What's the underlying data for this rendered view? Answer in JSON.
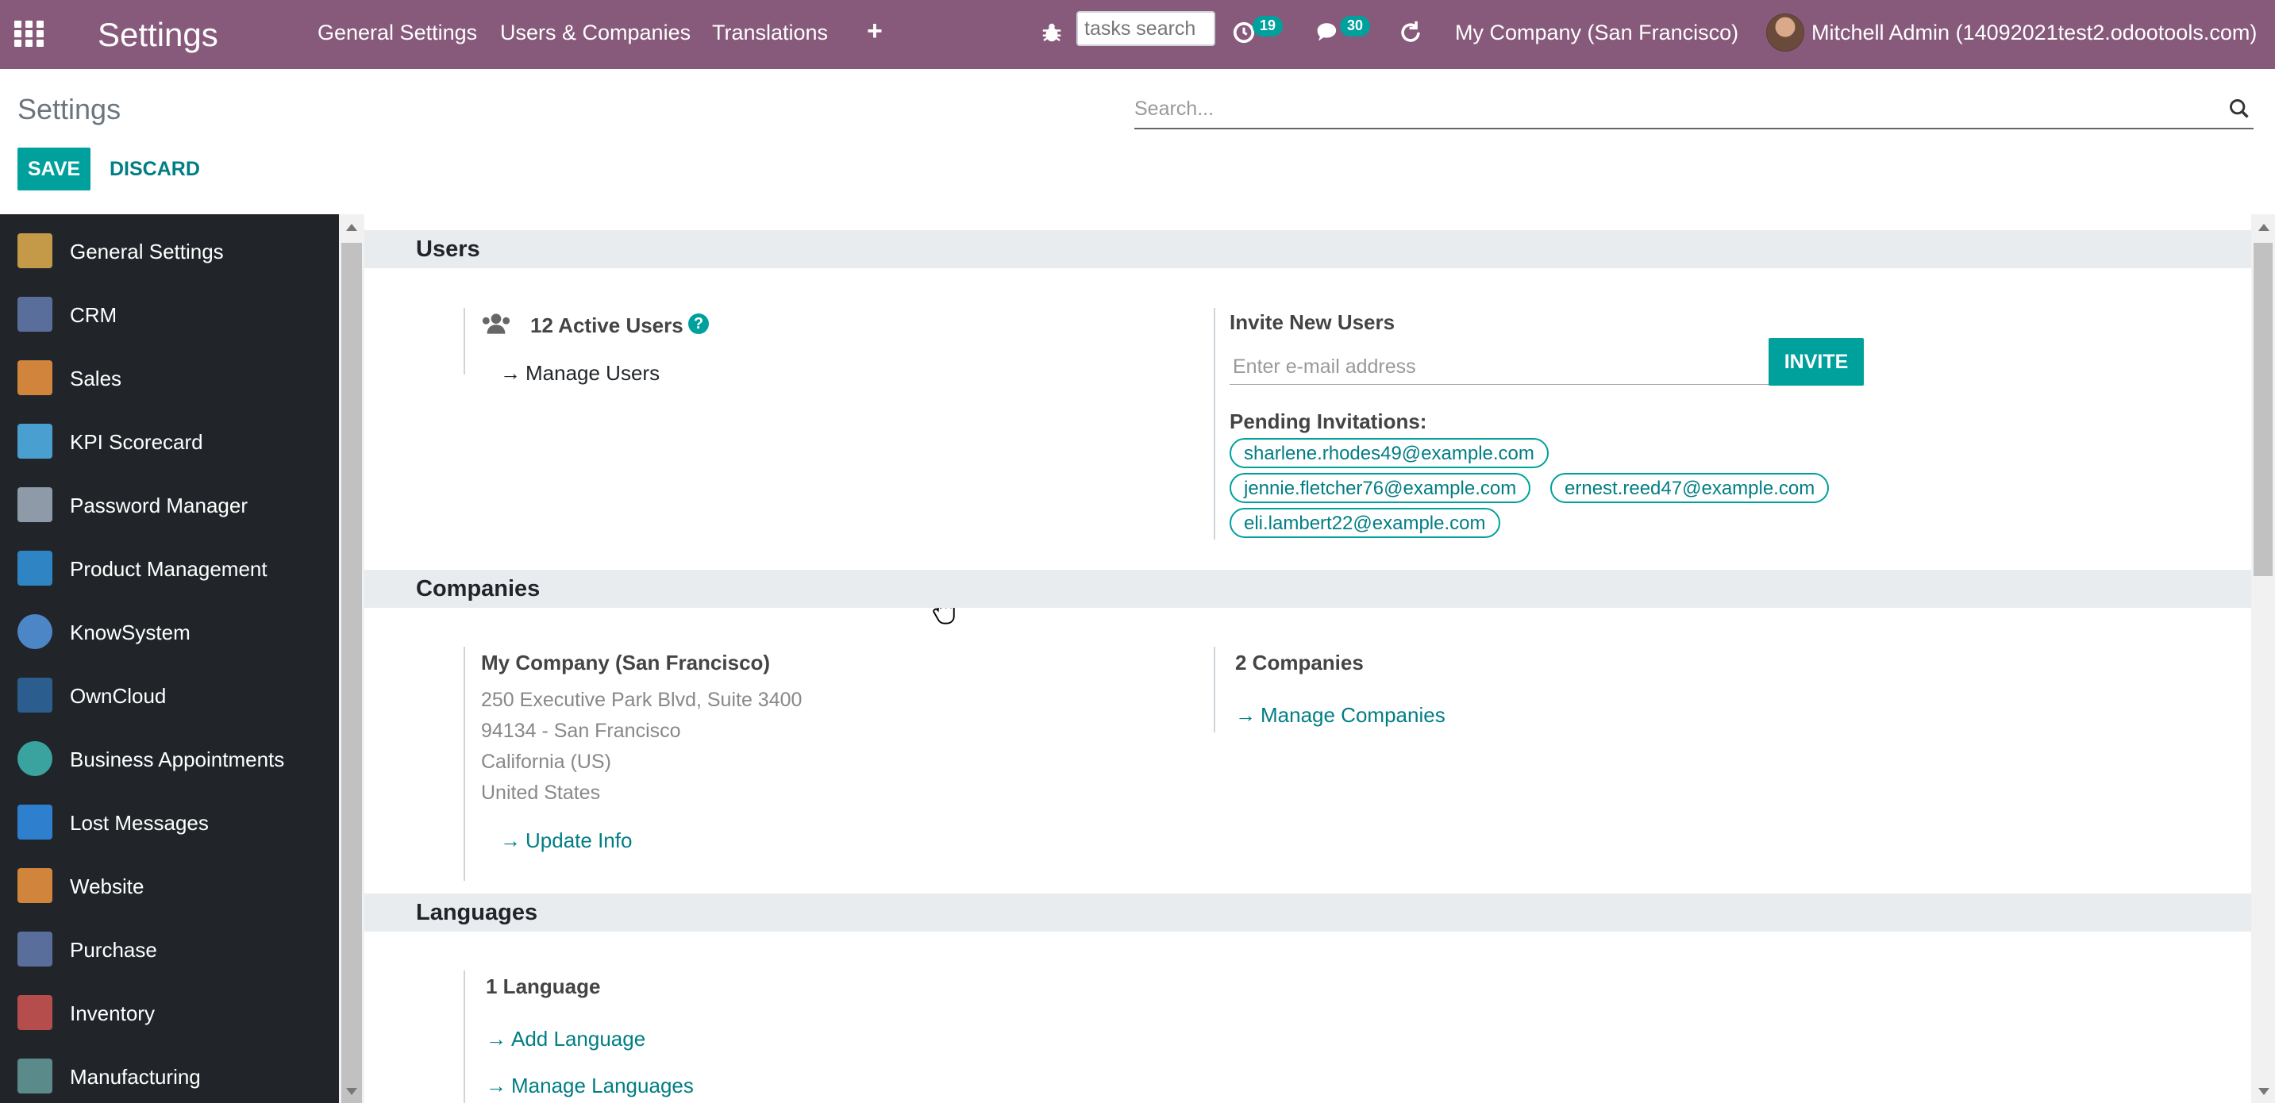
{
  "topbar": {
    "app_title": "Settings",
    "menu": [
      "General Settings",
      "Users & Companies",
      "Translations"
    ],
    "tasks_search_placeholder": "tasks search",
    "activity_count": "19",
    "messages_count": "30",
    "company": "My Company (San Francisco)",
    "user": "Mitchell Admin (14092021test2.odootools.com)"
  },
  "control_panel": {
    "title": "Settings",
    "save_label": "SAVE",
    "discard_label": "DISCARD",
    "search_placeholder": "Search..."
  },
  "sidebar": {
    "items": [
      {
        "label": "General Settings",
        "icon": "gear-icon",
        "color": "#c49a49"
      },
      {
        "label": "CRM",
        "icon": "handshake-icon",
        "color": "#5a6e9c"
      },
      {
        "label": "Sales",
        "icon": "chart-line-icon",
        "color": "#d0843c"
      },
      {
        "label": "KPI Scorecard",
        "icon": "scorecard-icon",
        "color": "#4a9fd1"
      },
      {
        "label": "Password Manager",
        "icon": "key-icon",
        "color": "#8e9aa8"
      },
      {
        "label": "Product Management",
        "icon": "sliders-icon",
        "color": "#2f84c4"
      },
      {
        "label": "KnowSystem",
        "icon": "brain-icon",
        "color": "#4c86c7"
      },
      {
        "label": "OwnCloud",
        "icon": "cloud-icon",
        "color": "#2c5d8f"
      },
      {
        "label": "Business Appointments",
        "icon": "clock-icon",
        "color": "#3aa3a0"
      },
      {
        "label": "Lost Messages",
        "icon": "user-question-icon",
        "color": "#2f7fcf"
      },
      {
        "label": "Website",
        "icon": "globe-icon",
        "color": "#d0843c"
      },
      {
        "label": "Purchase",
        "icon": "credit-card-icon",
        "color": "#5a6e9c"
      },
      {
        "label": "Inventory",
        "icon": "box-icon",
        "color": "#b54d4d"
      },
      {
        "label": "Manufacturing",
        "icon": "wrench-icon",
        "color": "#5a8a8a"
      }
    ]
  },
  "users": {
    "section_title": "Users",
    "active_users": "12 Active Users",
    "manage_users": "Manage Users",
    "invite_title": "Invite New Users",
    "invite_placeholder": "Enter e-mail address",
    "invite_button": "INVITE",
    "pending_title": "Pending Invitations:",
    "pending": [
      "sharlene.rhodes49@example.com",
      "jennie.fletcher76@example.com",
      "ernest.reed47@example.com",
      "eli.lambert22@example.com"
    ]
  },
  "companies": {
    "section_title": "Companies",
    "company_name": "My Company (San Francisco)",
    "address_lines": [
      "250 Executive Park Blvd, Suite 3400",
      "94134 - San Francisco",
      "California (US)",
      "United States"
    ],
    "update_info": "Update Info",
    "count": "2 Companies",
    "manage_companies": "Manage Companies"
  },
  "languages": {
    "section_title": "Languages",
    "count": "1 Language",
    "add_language": "Add Language",
    "manage_languages": "Manage Languages"
  }
}
